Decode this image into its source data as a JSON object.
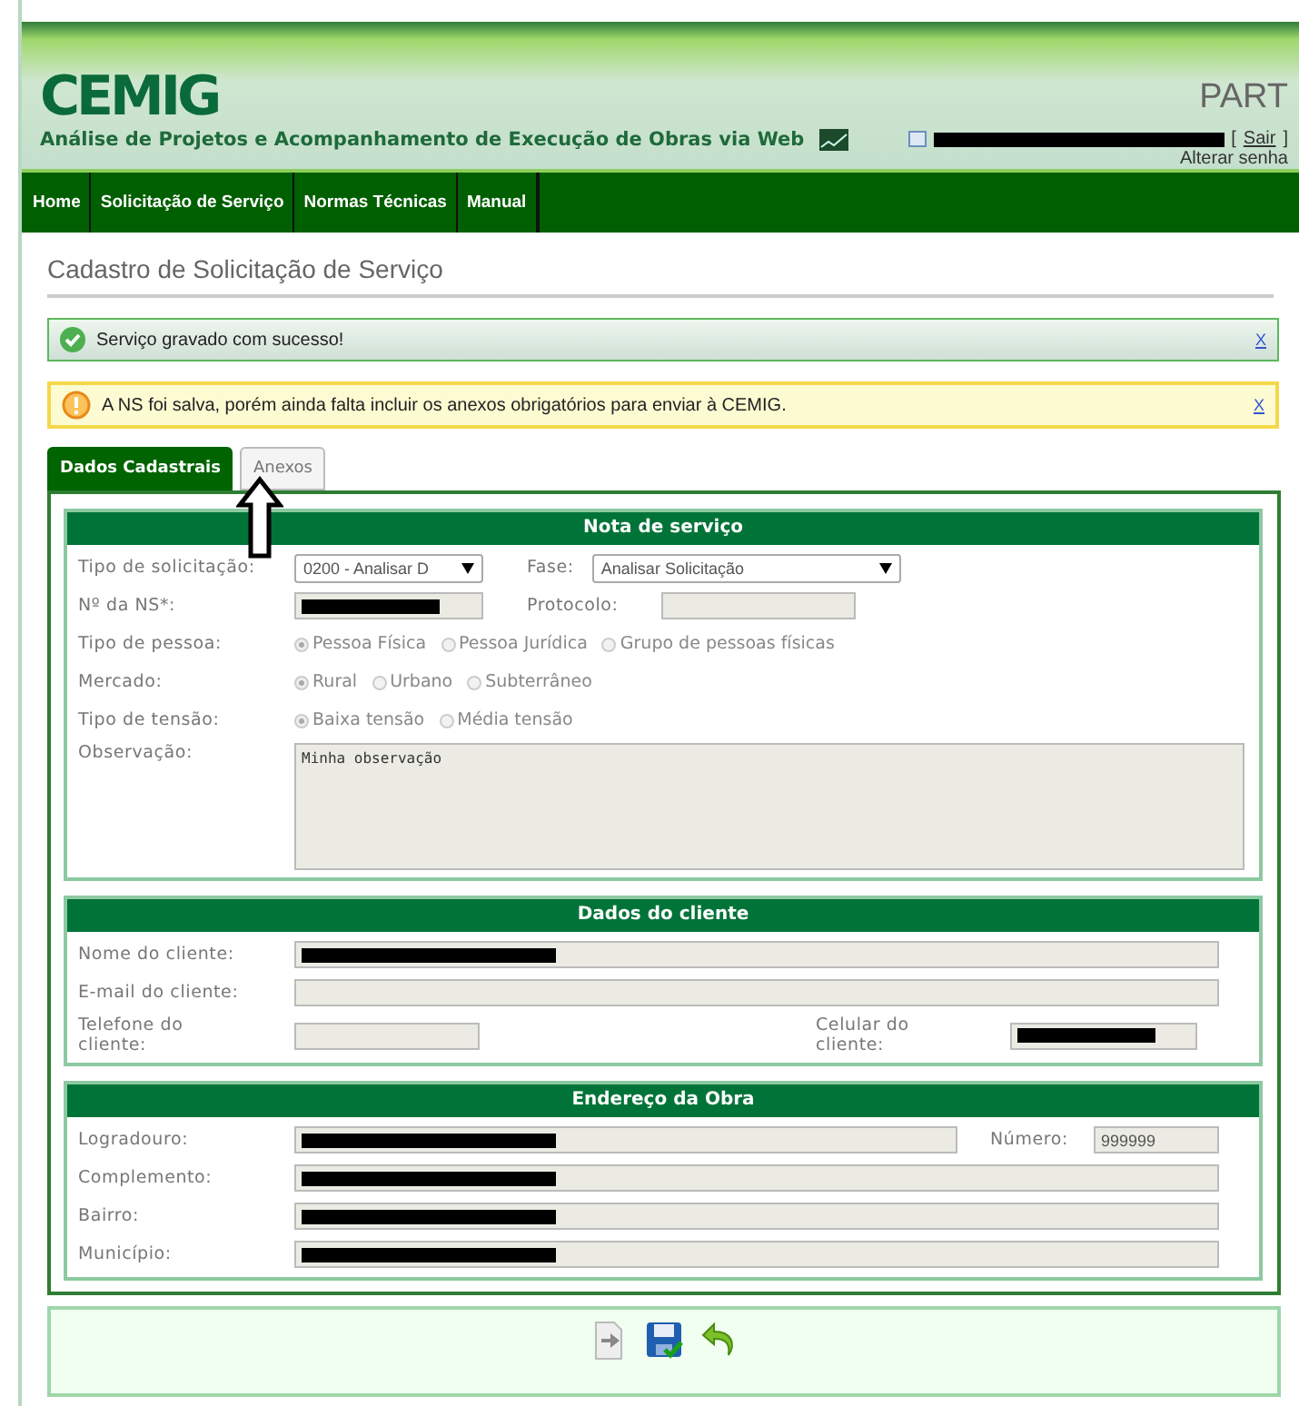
{
  "header": {
    "logo": "CEMIG",
    "subtitle": "Análise de Projetos e Acompanhamento de Execução de Obras via Web",
    "app_code": "PART",
    "user": {
      "redacted": true
    },
    "logout_open": "[",
    "logout": "Sair",
    "logout_close": "]",
    "change_password": "Alterar senha"
  },
  "nav": [
    "Home",
    "Solicitação de Serviço",
    "Normas Técnicas",
    "Manual"
  ],
  "page_title": "Cadastro de Solicitação de Serviço",
  "messages": [
    {
      "kind": "success",
      "text": "Serviço gravado com sucesso!",
      "close": "X"
    },
    {
      "kind": "warning",
      "text": "A NS foi salva, porém ainda falta incluir os anexos obrigatórios para enviar à CEMIG.",
      "close": "X"
    }
  ],
  "tabs": [
    {
      "label": "Dados Cadastrais",
      "selected": true
    },
    {
      "label": "Anexos",
      "selected": false
    }
  ],
  "sections": [
    {
      "title": "Nota de serviço",
      "rows": [
        {
          "kind": "pair",
          "items": [
            {
              "label": "Tipo de solicitação:",
              "kind": "select",
              "value": "0200 - Analisar D"
            },
            {
              "label": "Fase:",
              "kind": "select",
              "value": "Analisar Solicitação"
            }
          ]
        },
        {
          "kind": "pair",
          "items": [
            {
              "label": "Nº da NS*:",
              "kind": "field",
              "redacted": true
            },
            {
              "label": "Protocolo:",
              "kind": "field"
            }
          ]
        },
        {
          "kind": "radio",
          "label": "Tipo de pessoa:",
          "options": [
            {
              "label": "Pessoa Física",
              "selected": true
            },
            {
              "label": "Pessoa Jurídica",
              "selected": false
            },
            {
              "label": "Grupo de pessoas físicas",
              "selected": false
            }
          ]
        },
        {
          "kind": "radio",
          "label": "Mercado:",
          "options": [
            {
              "label": "Rural",
              "selected": true
            },
            {
              "label": "Urbano",
              "selected": false
            },
            {
              "label": "Subterrâneo",
              "selected": false
            }
          ]
        },
        {
          "kind": "radio",
          "label": "Tipo de tensão:",
          "options": [
            {
              "label": "Baixa tensão",
              "selected": true
            },
            {
              "label": "Média tensão",
              "selected": false
            }
          ]
        },
        {
          "kind": "textarea",
          "label": "Observação:",
          "value": "Minha observação"
        }
      ]
    },
    {
      "title": "Dados do cliente",
      "rows": [
        {
          "kind": "single",
          "items": [
            {
              "label": "Nome do cliente:",
              "kind": "field",
              "redacted": true
            }
          ]
        },
        {
          "kind": "single",
          "items": [
            {
              "label": "E-mail do cliente:",
              "kind": "field"
            }
          ]
        },
        {
          "kind": "spread",
          "items": [
            {
              "label": "Telefone do cliente:",
              "kind": "field"
            },
            {
              "label": "Celular do cliente:",
              "kind": "field",
              "redacted": true
            }
          ]
        }
      ]
    },
    {
      "title": "Endereço da Obra",
      "rows": [
        {
          "kind": "address",
          "items": [
            {
              "label": "Logradouro:",
              "kind": "field",
              "redacted": true
            },
            {
              "label": "Número:",
              "kind": "field",
              "value": "999999"
            }
          ]
        },
        {
          "kind": "single",
          "items": [
            {
              "label": "Complemento:",
              "kind": "field",
              "redacted": true
            }
          ]
        },
        {
          "kind": "single",
          "items": [
            {
              "label": "Bairro:",
              "kind": "field",
              "redacted": true
            }
          ]
        },
        {
          "kind": "single",
          "items": [
            {
              "label": "Município:",
              "kind": "field",
              "redacted": true
            }
          ]
        }
      ]
    }
  ],
  "actions": [
    {
      "kind": "attach"
    },
    {
      "kind": "save"
    },
    {
      "kind": "back"
    }
  ]
}
